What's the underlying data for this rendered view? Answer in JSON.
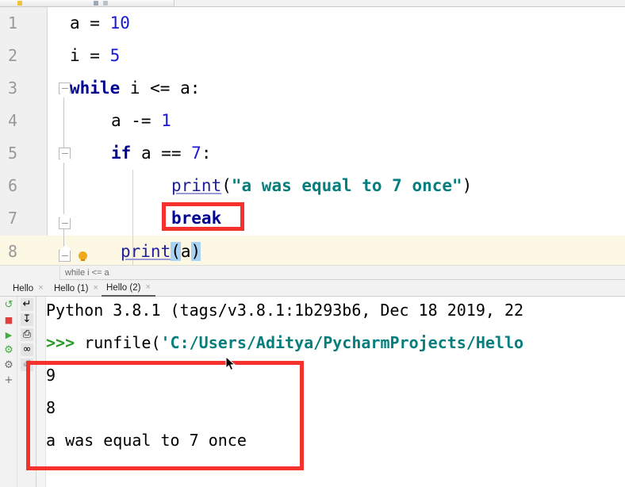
{
  "app": {
    "name": "PyCharm",
    "accent_red": "#f5312e",
    "keyword_color": "#00008f",
    "string_color": "#077e7e",
    "number_color": "#1717d6",
    "current_line_bg": "#fdf8e3",
    "gutter_bg": "#f0f0f0"
  },
  "editor": {
    "lines": [
      {
        "no": "1",
        "indent": 0
      },
      {
        "no": "2",
        "indent": 0
      },
      {
        "no": "3",
        "indent": 0
      },
      {
        "no": "4",
        "indent": 1
      },
      {
        "no": "5",
        "indent": 1
      },
      {
        "no": "6",
        "indent": 2
      },
      {
        "no": "7",
        "indent": 2
      },
      {
        "no": "8",
        "indent": 0
      }
    ],
    "code": {
      "l1_var": "a",
      "l1_eq": " = ",
      "l1_num": "10",
      "l2_var": "i",
      "l2_eq": " = ",
      "l2_num": "5",
      "l3_kw": "while",
      "l3_rest": " i <= a:",
      "l4_rest": "a -= ",
      "l4_num": "1",
      "l5_kw": "if",
      "l5_mid": " a == ",
      "l5_num": "7",
      "l5_end": ":",
      "l6_fn": "print",
      "l6_open": "(",
      "l6_str": "\"a was equal to 7 once\"",
      "l6_close": ")",
      "l7_kw": "break",
      "l8_fn": "print",
      "l8_open": "(",
      "l8_arg": "a",
      "l8_close": ")"
    },
    "breadcrumb": "while i <= a"
  },
  "tabs": [
    {
      "label": "Hello",
      "close": "×",
      "active": false
    },
    {
      "label": "Hello (1)",
      "close": "×",
      "active": false
    },
    {
      "label": "Hello (2)",
      "close": "×",
      "active": true
    }
  ],
  "console_toolbar": {
    "column_a": [
      {
        "name": "rerun-icon",
        "glyph": "↺",
        "color": "#3fae3f"
      },
      {
        "name": "stop-icon",
        "glyph": "■",
        "color": "#e04040"
      },
      {
        "name": "run-icon",
        "glyph": "▶",
        "color": "#3fae3f"
      },
      {
        "name": "debug-icon",
        "glyph": "⚙",
        "color": "#3fae3f"
      },
      {
        "name": "settings-icon",
        "glyph": "⚙",
        "color": "#6b6b6b"
      },
      {
        "name": "add-icon",
        "glyph": "+",
        "color": "#6b6b6b"
      }
    ],
    "column_b": [
      {
        "name": "soft-wrap-icon",
        "glyph": "↵",
        "color": "#5a5a5a"
      },
      {
        "name": "scroll-to-end-icon",
        "glyph": "↧",
        "color": "#5a5a5a"
      },
      {
        "name": "print-icon",
        "glyph": "⎙",
        "color": "#5a5a5a"
      },
      {
        "name": "history-icon",
        "glyph": "∞",
        "color": "#5a5a5a"
      },
      {
        "name": "attach-icon",
        "glyph": "✐",
        "color": "#8a8a8a"
      }
    ]
  },
  "console": {
    "banner": "Python 3.8.1 (tags/v3.8.1:1b293b6, Dec 18 2019, 22",
    "prompt": ">>> ",
    "run_call": "runfile(",
    "run_path": "'C:/Users/Aditya/PycharmProjects/Hello",
    "output": [
      "9",
      "8",
      "a was equal to 7 once"
    ]
  },
  "annotations": [
    {
      "name": "break-highlight-box",
      "target": "break"
    },
    {
      "name": "output-highlight-box",
      "target": "console output"
    }
  ]
}
